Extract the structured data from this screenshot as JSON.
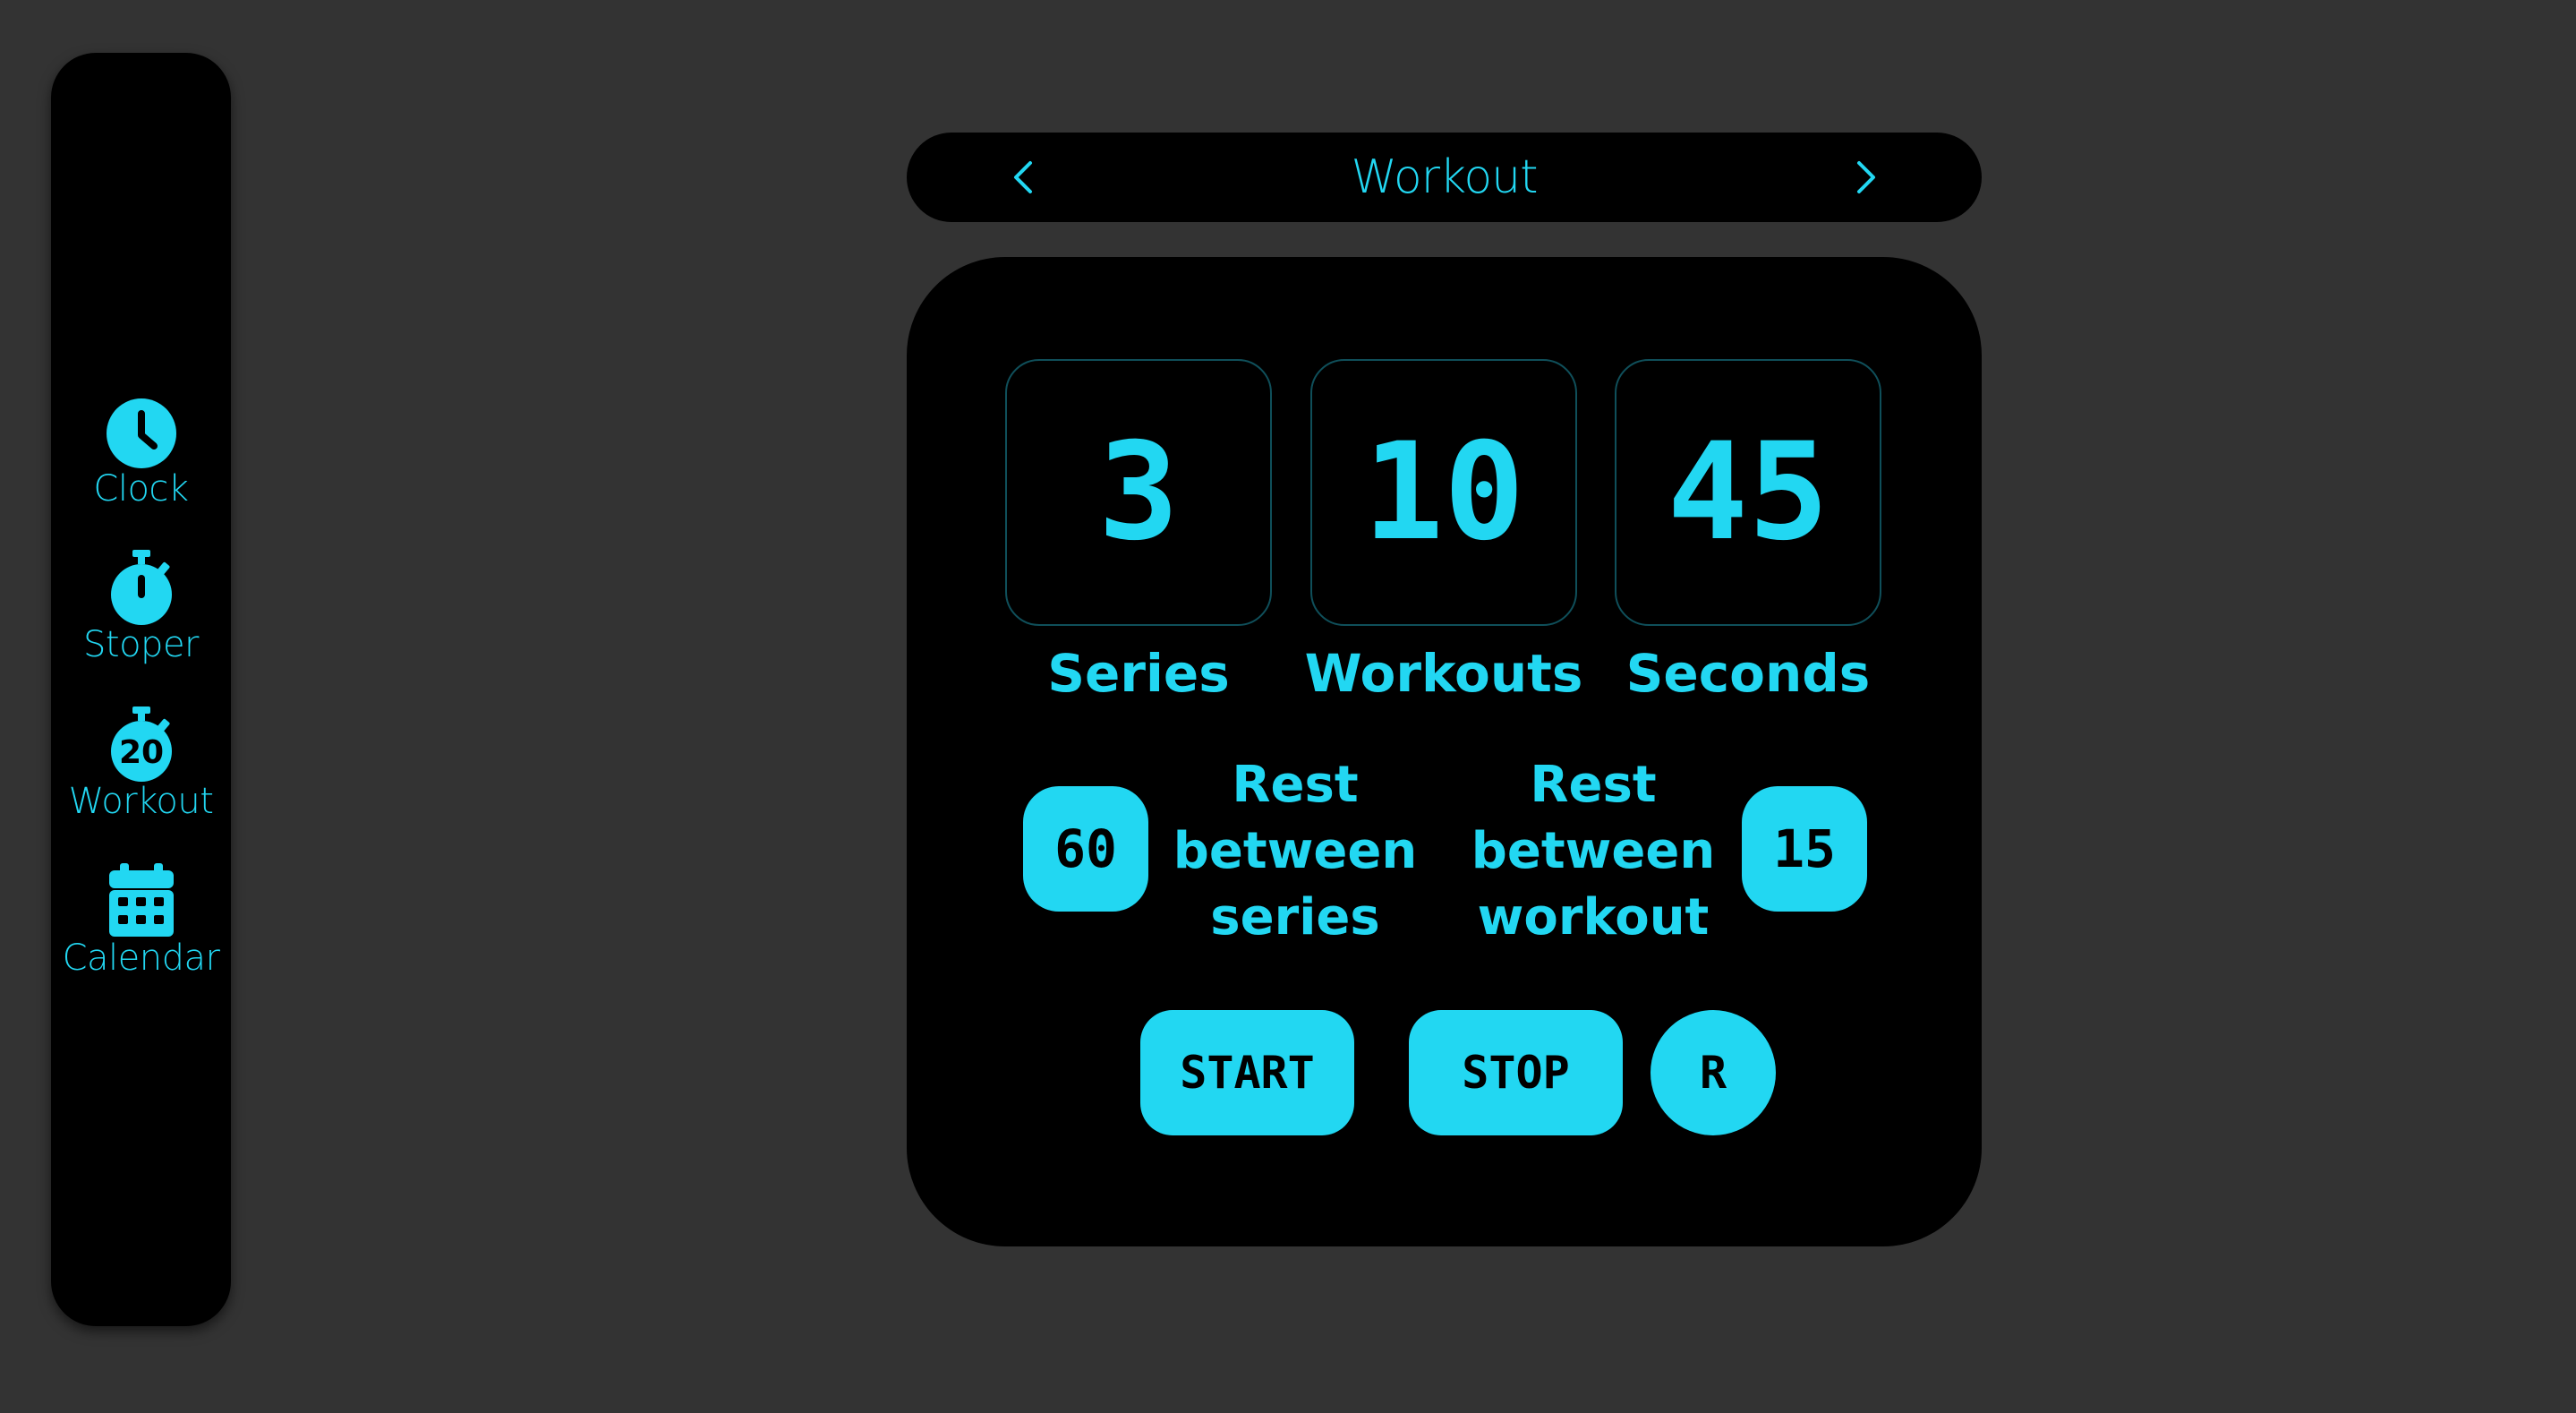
{
  "sidebar": {
    "items": [
      {
        "label": "Clock",
        "icon": "clock-icon"
      },
      {
        "label": "Stoper",
        "icon": "stopwatch-icon"
      },
      {
        "label": "Workout",
        "icon": "workout-timer-icon",
        "badge": "20"
      },
      {
        "label": "Calendar",
        "icon": "calendar-icon"
      }
    ]
  },
  "header": {
    "title": "Workout",
    "prev_icon": "chevron-left-icon",
    "next_icon": "chevron-right-icon"
  },
  "counters": [
    {
      "value": "3",
      "label": "Series"
    },
    {
      "value": "10",
      "label": "Workouts"
    },
    {
      "value": "45",
      "label": "Seconds"
    }
  ],
  "rest": {
    "between_series": {
      "value": "60",
      "label_lines": [
        "Rest",
        "between",
        "series"
      ]
    },
    "between_workout": {
      "value": "15",
      "label_lines": [
        "Rest",
        "between",
        "workout"
      ]
    }
  },
  "controls": {
    "start_label": "START",
    "stop_label": "STOP",
    "reset_label": "R"
  },
  "colors": {
    "accent": "#22d7f2",
    "background": "#333333",
    "panel": "#000000"
  }
}
